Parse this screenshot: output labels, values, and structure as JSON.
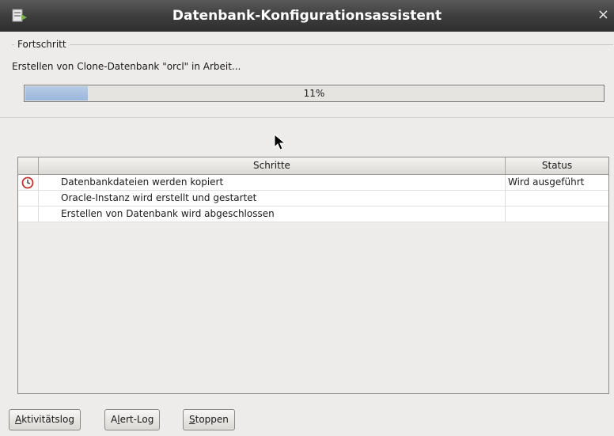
{
  "window": {
    "title": "Datenbank-Konfigurationsassistent",
    "close_glyph": "×",
    "app_icon": "database-wizard-icon"
  },
  "progress_group": {
    "legend": "Fortschritt",
    "status_text": "Erstellen von Clone-Datenbank \"orcl\" in Arbeit...",
    "percent": 11,
    "percent_label": "11%"
  },
  "steps_table": {
    "columns": {
      "steps": "Schritte",
      "status": "Status"
    },
    "rows": [
      {
        "icon": "clock-icon",
        "step": "Datenbankdateien werden kopiert",
        "status": "Wird ausgeführt"
      },
      {
        "icon": "",
        "step": "Oracle-Instanz wird erstellt und gestartet",
        "status": ""
      },
      {
        "icon": "",
        "step": "Erstellen von Datenbank wird abgeschlossen",
        "status": ""
      }
    ]
  },
  "buttons": {
    "activity_log": {
      "mnemonic": "A",
      "rest": "ktivitätslog"
    },
    "alert_log": {
      "pre": "A",
      "mnemonic": "l",
      "rest": "ert-Log"
    },
    "stop": {
      "mnemonic": "S",
      "rest": "toppen"
    }
  },
  "colors": {
    "titlebar": "#3e3e3e",
    "progress_fill": "#9bb6dc",
    "background": "#edeceb"
  }
}
